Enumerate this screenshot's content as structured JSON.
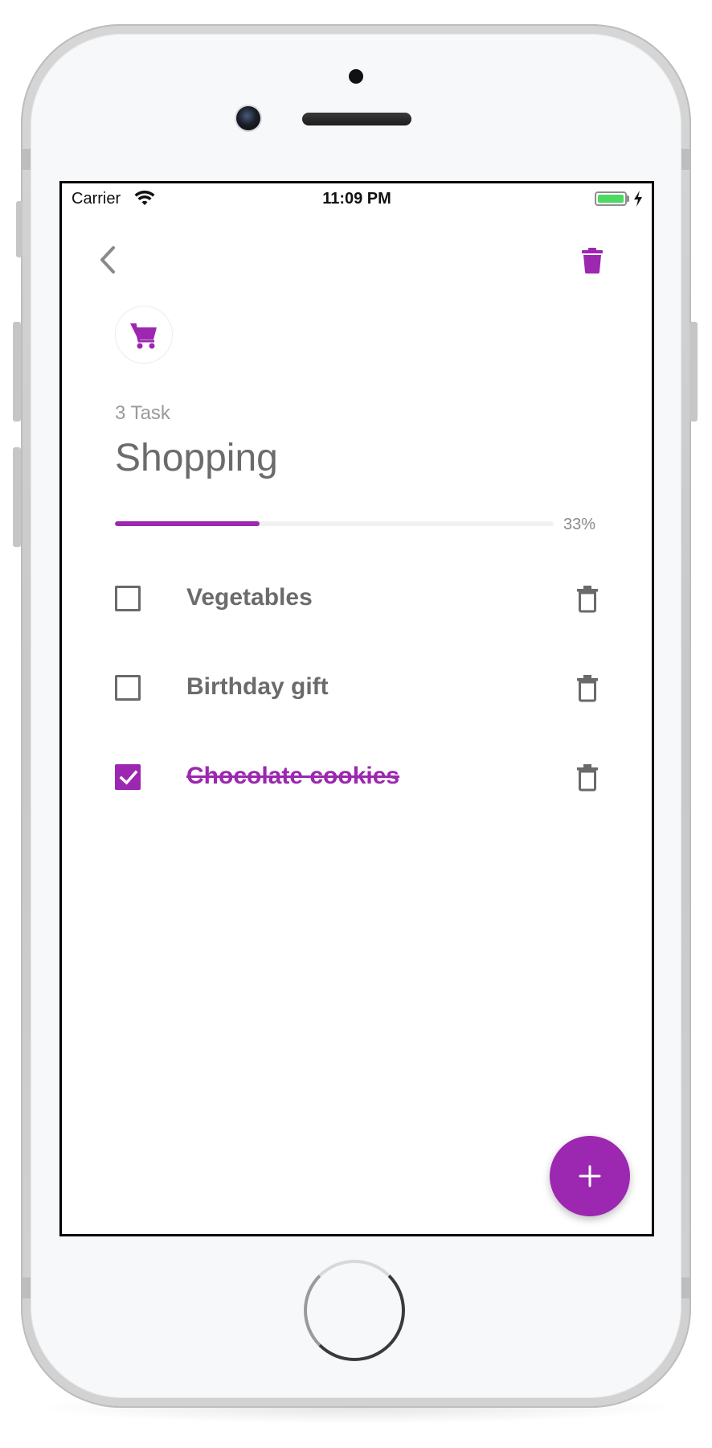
{
  "status_bar": {
    "carrier": "Carrier",
    "time": "11:09 PM",
    "wifi_icon": "wifi-icon",
    "battery_icon": "battery-charging-icon"
  },
  "header": {
    "back_icon": "chevron-left-icon",
    "delete_icon": "trash-icon"
  },
  "list": {
    "category_icon": "shopping-cart-icon",
    "task_count": "3 Task",
    "title": "Shopping",
    "progress": 0.33,
    "progress_label": "33%"
  },
  "tasks": [
    {
      "label": "Vegetables",
      "completed": false
    },
    {
      "label": "Birthday gift",
      "completed": false
    },
    {
      "label": "Chocolate cookies",
      "completed": true
    }
  ],
  "fab": {
    "icon": "plus-icon"
  },
  "colors": {
    "accent": "#9c27b0",
    "text": "#6b6b6b",
    "muted": "#9a9a9a",
    "track": "#f1f1f1"
  }
}
